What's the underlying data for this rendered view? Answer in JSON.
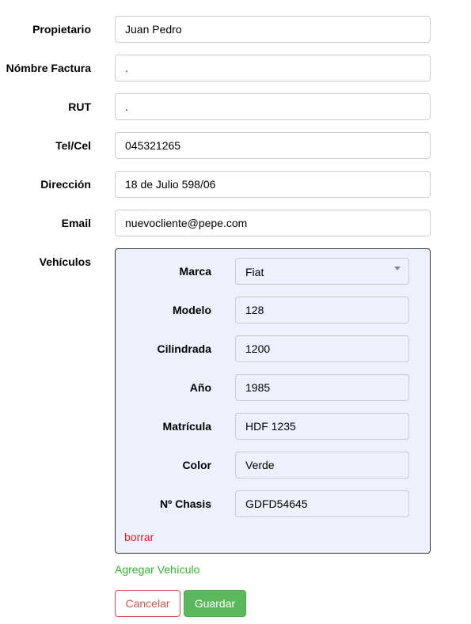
{
  "owner_fields": [
    {
      "label": "Propietario",
      "value": "Juan Pedro"
    },
    {
      "label": "Nómbre Factura",
      "value": "."
    },
    {
      "label": "RUT",
      "value": "."
    },
    {
      "label": "Tel/Cel",
      "value": "045321265"
    },
    {
      "label": "Dirección",
      "value": "18 de Julio 598/06"
    },
    {
      "label": "Email",
      "value": "nuevocliente@pepe.com"
    }
  ],
  "vehicles": {
    "label": "Vehículos",
    "brand": {
      "label": "Marca",
      "selected": "Fiat"
    },
    "fields": [
      {
        "label": "Modelo",
        "value": "128"
      },
      {
        "label": "Cilindrada",
        "value": "1200"
      },
      {
        "label": "Año",
        "value": "1985"
      },
      {
        "label": "Matrícula",
        "value": "HDF 1235"
      },
      {
        "label": "Color",
        "value": "Verde"
      },
      {
        "label": "Nº Chasis",
        "value": "GDFD54645"
      }
    ],
    "delete_label": "borrar",
    "add_label": "Agregar Vehículo"
  },
  "actions": {
    "cancel_label": "Cancelar",
    "save_label": "Guardar"
  },
  "colors": {
    "panel_bg": "#eef0fb",
    "delete": "#e0202a",
    "add": "#2db82d",
    "cancel": "#d9534f",
    "save": "#5cb85c"
  }
}
